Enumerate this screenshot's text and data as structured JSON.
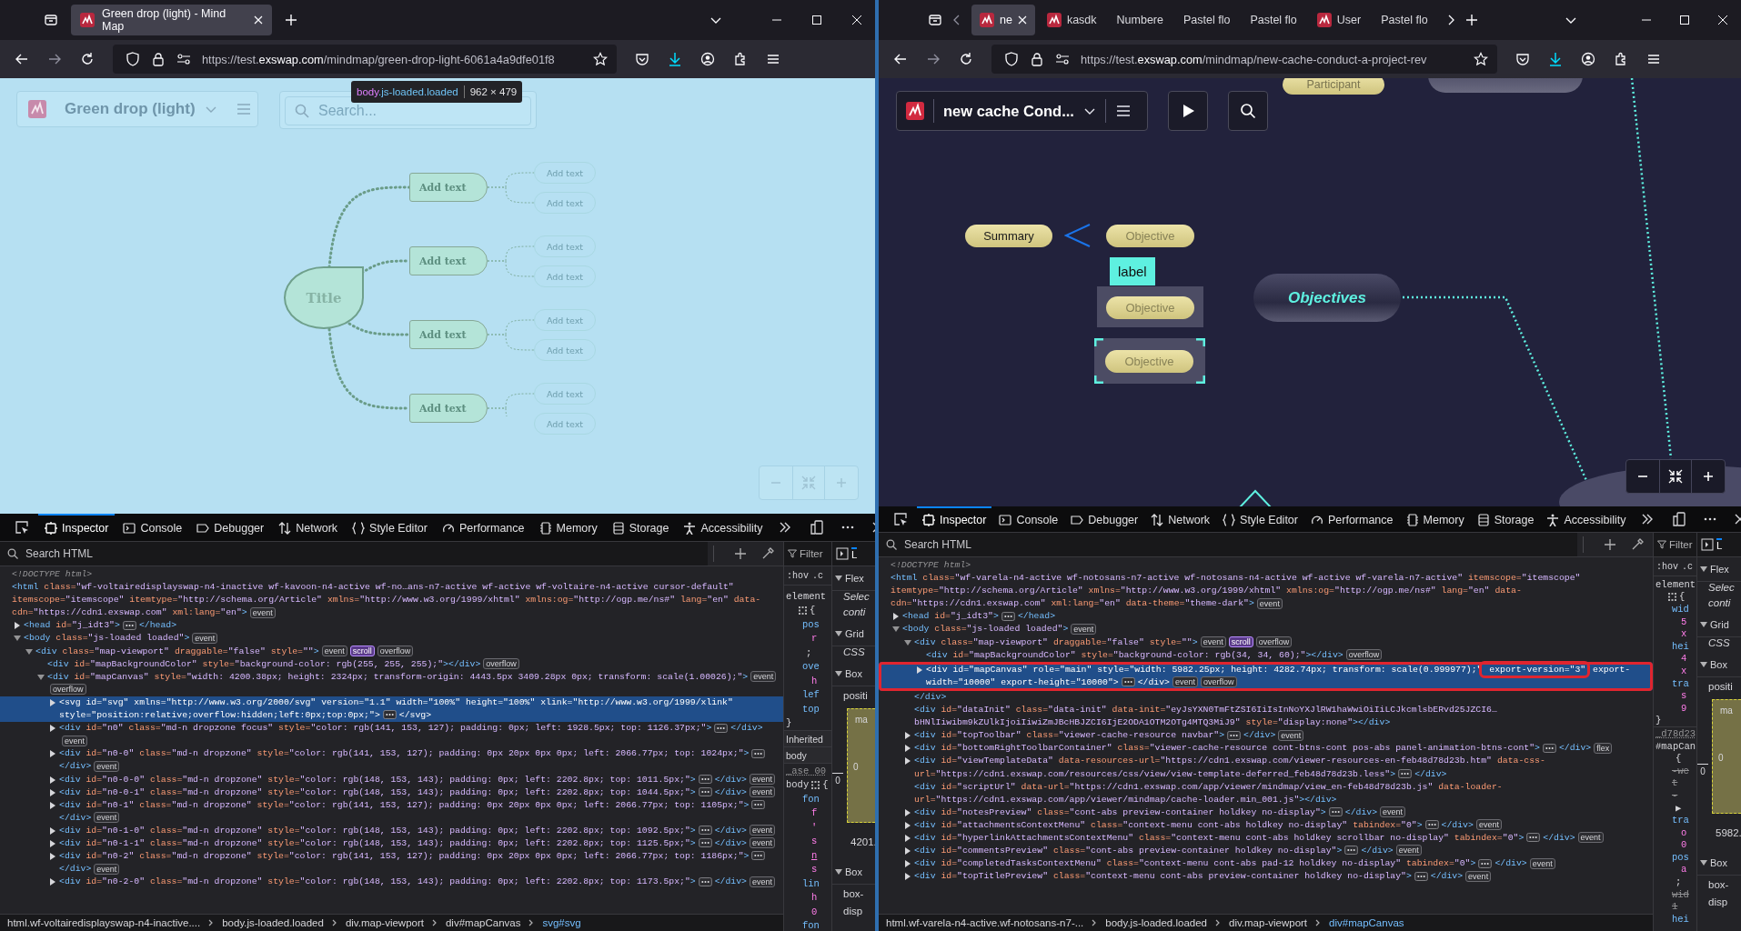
{
  "windows": [
    {
      "tabs": [
        {
          "title": "Green drop (light) - Mind Map",
          "selected": true,
          "favicon": true
        }
      ],
      "url": {
        "scheme": "https://test.",
        "host": "exswap.com",
        "path": "/mindmap/green-drop-light-6061a4a9dfe01f8"
      },
      "page": {
        "kind": "light-map",
        "title": "Green drop (light)",
        "search": {
          "placeholder": "Search..."
        },
        "tooltip": {
          "tag": "body",
          "classes": ".js-loaded.loaded",
          "size": "962 × 479"
        },
        "root": "Title",
        "branches": [
          {
            "label": "Add text",
            "leaves": [
              "Add text",
              "Add text"
            ]
          },
          {
            "label": "Add text",
            "leaves": [
              "Add text",
              "Add text"
            ]
          },
          {
            "label": "Add text",
            "leaves": [
              "Add text",
              "Add text"
            ]
          },
          {
            "label": "Add text",
            "leaves": [
              "Add text",
              "Add text"
            ]
          }
        ]
      },
      "devtools": {
        "tabs": [
          {
            "label": "Inspector",
            "kind": "inspector",
            "selected": true
          },
          {
            "label": "Console",
            "kind": "console",
            "selected": false
          },
          {
            "label": "Debugger",
            "kind": "debugger",
            "selected": false
          },
          {
            "label": "Network",
            "kind": "network",
            "selected": false
          },
          {
            "label": "Style Editor",
            "kind": "styles",
            "selected": false
          },
          {
            "label": "Performance",
            "kind": "performance",
            "selected": false
          },
          {
            "label": "Memory",
            "kind": "memory",
            "selected": false
          },
          {
            "label": "Storage",
            "kind": "storage",
            "selected": false
          },
          {
            "label": "Accessibility",
            "kind": "accessibility",
            "selected": false
          }
        ],
        "search": {
          "placeholder": "Search HTML"
        },
        "tree": [
          {
            "text": "<!DOCTYPE html>",
            "kind": "leaf",
            "selected": false
          },
          {
            "text": "<html class=\"wf-voltairedisplayswap-n4-inactive wf-kavoon-n4-active wf-no…ans-n7-active wf-active wf-voltaire-n4-active cursor-default\" itemscope=\"itemscope\" itemtype=\"http://schema.org/Article\" xmlns=\"http://www.w3.org/1999/xhtml\" xmlns:og=\"http://ogp.me/ns#\" lang=\"en\" data-cdn=\"https://cdn1.exswap.com\" xml:lang=\"en\">",
            "kind": "leaf",
            "selected": false,
            "badges": [
              {
                "label": "event",
                "active": false
              }
            ],
            "children": [
              {
                "text": "<head id=\"j_idt3\">",
                "ellipsis": true,
                "closing": "</head>",
                "kind": "collapsed",
                "selected": false
              },
              {
                "text": "<body class=\"js-loaded loaded\">",
                "kind": "expanded",
                "selected": false,
                "badges": [
                  {
                    "label": "event",
                    "active": false
                  }
                ],
                "children": [
                  {
                    "text": "<div class=\"map-viewport\" draggable=\"false\" style=\"\">",
                    "kind": "expanded",
                    "selected": false,
                    "badges": [
                      {
                        "label": "event",
                        "active": false
                      },
                      {
                        "label": "scroll",
                        "active": true
                      },
                      {
                        "label": "overflow",
                        "active": false
                      }
                    ],
                    "children": [
                      {
                        "text": "<div id=\"mapBackgroundColor\" style=\"background-color: rgb(255, 255, 255);\">",
                        "ellipsis": false,
                        "closing": "</div>",
                        "kind": "leaf",
                        "selected": false,
                        "badges": [
                          {
                            "label": "overflow",
                            "active": false
                          }
                        ]
                      },
                      {
                        "text": "<div id=\"mapCanvas\" style=\"width: 4200.38px; height: 2324px; transform-origin: 4443.5px 3409.28px 0px; transform: scale(1.00026);\">",
                        "kind": "expanded",
                        "selected": false,
                        "badges": [
                          {
                            "label": "event",
                            "active": false
                          },
                          {
                            "label": "overflow",
                            "active": false
                          }
                        ],
                        "children": [
                          {
                            "text": "<svg id=\"svg\" xmlns=\"http://www.w3.org/2000/svg\" version=\"1.1\" width=\"100%\" height=\"100%\" xlink=\"http://www.w3.org/1999/xlink\" style=\"position:relative;overflow:hidden;left:0px;top:0px;\">",
                            "ellipsis": true,
                            "closing": "</svg>",
                            "kind": "collapsed",
                            "selected": true
                          },
                          {
                            "text": "<div id=\"n0\" class=\"md-n dropzone focus\" style=\"color: rgb(141, 153, 127); padding: 0px; left: 1928.5px; top: 1126.37px;\">",
                            "ellipsis": true,
                            "closing": "</div>",
                            "kind": "collapsed",
                            "selected": false,
                            "badges": [
                              {
                                "label": "event",
                                "active": false
                              }
                            ]
                          },
                          {
                            "text": "<div id=\"n0-0\" class=\"md-n dropzone\" style=\"color: rgb(141, 153, 127); padding: 0px 20px 0px 0px; left: 2066.77px; top: 1024px;\">",
                            "ellipsis": true,
                            "closing": "</div>",
                            "kind": "collapsed",
                            "selected": false,
                            "badges": [
                              {
                                "label": "event",
                                "active": false
                              }
                            ]
                          },
                          {
                            "text": "<div id=\"n0-0-0\" class=\"md-n dropzone\" style=\"color: rgb(148, 153, 143); padding: 0px; left: 2202.8px; top: 1011.5px;\">",
                            "ellipsis": true,
                            "closing": "</div>",
                            "kind": "collapsed",
                            "selected": false,
                            "badges": [
                              {
                                "label": "event",
                                "active": false
                              }
                            ]
                          },
                          {
                            "text": "<div id=\"n0-0-1\" class=\"md-n dropzone\" style=\"color: rgb(148, 153, 143); padding: 0px; left: 2202.8px; top: 1044.5px;\">",
                            "ellipsis": true,
                            "closing": "</div>",
                            "kind": "collapsed",
                            "selected": false,
                            "badges": [
                              {
                                "label": "event",
                                "active": false
                              }
                            ]
                          },
                          {
                            "text": "<div id=\"n0-1\" class=\"md-n dropzone\" style=\"color: rgb(141, 153, 127); padding: 0px 20px 0px 0px; left: 2066.77px; top: 1105px;\">",
                            "ellipsis": true,
                            "closing": "</div>",
                            "kind": "collapsed",
                            "selected": false,
                            "badges": [
                              {
                                "label": "event",
                                "active": false
                              }
                            ]
                          },
                          {
                            "text": "<div id=\"n0-1-0\" class=\"md-n dropzone\" style=\"color: rgb(148, 153, 143); padding: 0px; left: 2202.8px; top: 1092.5px;\">",
                            "ellipsis": true,
                            "closing": "</div>",
                            "kind": "collapsed",
                            "selected": false,
                            "badges": [
                              {
                                "label": "event",
                                "active": false
                              }
                            ]
                          },
                          {
                            "text": "<div id=\"n0-1-1\" class=\"md-n dropzone\" style=\"color: rgb(148, 153, 143); padding: 0px; left: 2202.8px; top: 1125.5px;\">",
                            "ellipsis": true,
                            "closing": "</div>",
                            "kind": "collapsed",
                            "selected": false,
                            "badges": [
                              {
                                "label": "event",
                                "active": false
                              }
                            ]
                          },
                          {
                            "text": "<div id=\"n0-2\" class=\"md-n dropzone\" style=\"color: rgb(141, 153, 127); padding: 0px 20px 0px 0px; left: 2066.77px; top: 1186px;\">",
                            "ellipsis": true,
                            "closing": "</div>",
                            "kind": "collapsed",
                            "selected": false,
                            "badges": [
                              {
                                "label": "event",
                                "active": false
                              }
                            ]
                          },
                          {
                            "text": "<div id=\"n0-2-0\" class=\"md-n dropzone\" style=\"color: rgb(148, 153, 143); padding: 0px; left: 2202.8px; top: 1173.5px;\">",
                            "ellipsis": true,
                            "closing": "</div>",
                            "kind": "collapsed",
                            "selected": false,
                            "badges": [
                              {
                                "label": "event",
                                "active": false
                              }
                            ]
                          }
                        ]
                      }
                    ]
                  }
                ]
              }
            ]
          }
        ],
        "breadcrumbs": [
          {
            "label": "html.wf-voltairedisplayswap-n4-inactive....",
            "selected": false
          },
          {
            "label": "body.js-loaded.loaded",
            "selected": false
          },
          {
            "label": "div.map-viewport",
            "selected": false
          },
          {
            "label": "div#mapCanvas",
            "selected": false
          },
          {
            "label": "svg#svg",
            "selected": true
          }
        ],
        "rules": {
          "filter": "Filter",
          "pseudo": ":hov",
          "classes": ".c",
          "lines": [
            {
              "text": "element",
              "kind": "selector"
            },
            {
              "text": "{",
              "kind": "open"
            },
            {
              "text": "pos",
              "kind": "prop"
            },
            {
              "text": "r",
              "kind": "value"
            },
            {
              "text": ";",
              "kind": "plain"
            },
            {
              "text": "ove",
              "kind": "prop"
            },
            {
              "text": "h",
              "kind": "value"
            },
            {
              "text": "lef",
              "kind": "prop"
            },
            {
              "text": "top",
              "kind": "prop"
            },
            {
              "text": "}",
              "kind": "close"
            },
            {
              "text": "Inherited",
              "kind": "header"
            },
            {
              "text": "body",
              "kind": "header"
            },
            {
              "text": "_ase 00",
              "kind": "source"
            },
            {
              "text": "body",
              "kind": "selector-open",
              "suffix": "{"
            },
            {
              "text": "fon",
              "kind": "prop"
            },
            {
              "text": "f",
              "kind": "value"
            },
            {
              "text": "'",
              "kind": "value"
            },
            {
              "text": "s",
              "kind": "value"
            },
            {
              "text": "n",
              "kind": "link"
            },
            {
              "text": "s",
              "kind": "value"
            },
            {
              "text": "lin",
              "kind": "prop"
            },
            {
              "text": "h",
              "kind": "value"
            },
            {
              "text": "0",
              "kind": "value"
            },
            {
              "text": "fon",
              "kind": "prop"
            }
          ]
        },
        "layout": {
          "tab": "L",
          "lines": [
            {
              "kind": "section",
              "text": "Flex"
            },
            {
              "kind": "note",
              "text": "Selec"
            },
            {
              "kind": "note",
              "text": "conti"
            },
            {
              "kind": "section",
              "text": "Grid"
            },
            {
              "kind": "note",
              "text": "CSS"
            },
            {
              "kind": "section",
              "text": "Box"
            },
            {
              "kind": "label",
              "text": "positi"
            },
            {
              "kind": "box-model",
              "label": "ma",
              "inner": "0",
              "outer": "0"
            },
            {
              "kind": "size",
              "text": "4201."
            },
            {
              "kind": "section",
              "text": "Box"
            },
            {
              "kind": "label",
              "text": "box-"
            },
            {
              "kind": "label",
              "text": "disp"
            }
          ]
        }
      }
    },
    {
      "tabs": [
        {
          "title": "ne",
          "selected": true,
          "favicon": true
        },
        {
          "title": "kasdk",
          "selected": false,
          "favicon": true
        },
        {
          "title": "Numbere",
          "selected": false,
          "favicon": false
        },
        {
          "title": "Pastel flo",
          "selected": false,
          "favicon": false
        },
        {
          "title": "Pastel flo",
          "selected": false,
          "favicon": false
        },
        {
          "title": "User",
          "selected": false,
          "favicon": true
        },
        {
          "title": "Pastel flo",
          "selected": false,
          "favicon": false
        }
      ],
      "tab_scroll": true,
      "url": {
        "scheme": "https://test.",
        "host": "exswap.com",
        "path": "/mindmap/new-cache-conduct-a-project-rev"
      },
      "page": {
        "kind": "dark-map",
        "title": "new cache Cond...",
        "top_node": "Participant",
        "summary": "Summary",
        "central": "Objectives",
        "objectives": [
          {
            "label": "Objective",
            "kind": "plain"
          },
          {
            "label": "Objective",
            "kind": "boxed",
            "tag": "label"
          },
          {
            "label": "Objective",
            "kind": "selected"
          }
        ]
      },
      "devtools": {
        "tabs": [
          {
            "label": "Inspector",
            "kind": "inspector",
            "selected": true
          },
          {
            "label": "Console",
            "kind": "console",
            "selected": false
          },
          {
            "label": "Debugger",
            "kind": "debugger",
            "selected": false
          },
          {
            "label": "Network",
            "kind": "network",
            "selected": false
          },
          {
            "label": "Style Editor",
            "kind": "styles",
            "selected": false
          },
          {
            "label": "Performance",
            "kind": "performance",
            "selected": false
          },
          {
            "label": "Memory",
            "kind": "memory",
            "selected": false
          },
          {
            "label": "Storage",
            "kind": "storage",
            "selected": false
          },
          {
            "label": "Accessibility",
            "kind": "accessibility",
            "selected": false
          }
        ],
        "search": {
          "placeholder": "Search HTML"
        },
        "tree": [
          {
            "text": "<!DOCTYPE html>",
            "kind": "leaf",
            "selected": false
          },
          {
            "text": "<html class=\"wf-varela-n4-active wf-notosans-n7-active wf-notosans-n4-active wf-active wf-varela-n7-active\" itemscope=\"itemscope\" itemtype=\"http://schema.org/Article\" xmlns=\"http://www.w3.org/1999/xhtml\" xmlns:og=\"http://ogp.me/ns#\" lang=\"en\" data-cdn=\"https://cdn1.exswap.com\" xml:lang=\"en\" data-theme=\"theme-dark\">",
            "kind": "leaf",
            "selected": false,
            "badges": [
              {
                "label": "event",
                "active": false
              }
            ],
            "children": [
              {
                "text": "<head id=\"j_idt3\">",
                "ellipsis": true,
                "closing": "</head>",
                "kind": "collapsed",
                "selected": false
              },
              {
                "text": "<body class=\"js-loaded loaded\">",
                "kind": "expanded",
                "selected": false,
                "badges": [
                  {
                    "label": "event",
                    "active": false
                  }
                ],
                "children": [
                  {
                    "text": "<div class=\"map-viewport\" draggable=\"false\" style=\"\">",
                    "kind": "expanded",
                    "selected": false,
                    "badges": [
                      {
                        "label": "event",
                        "active": false
                      },
                      {
                        "label": "scroll",
                        "active": true
                      },
                      {
                        "label": "overflow",
                        "active": false
                      }
                    ],
                    "children": [
                      {
                        "text": "<div id=\"mapBackgroundColor\" style=\"background-color: rgb(34, 34, 60);\">",
                        "ellipsis": false,
                        "closing": "</div>",
                        "kind": "leaf",
                        "selected": false,
                        "badges": [
                          {
                            "label": "overflow",
                            "active": false
                          }
                        ]
                      },
                      {
                        "text": "<div id=\"mapCanvas\" role=\"main\" style=\"width: 5982.25px; height: 4282.74px; transform: scale(0.999977);\"",
                        "marked": "export-version=\"3\"",
                        "after": " export-width=\"10000\" export-height=\"10000\">",
                        "ellipsis": true,
                        "closing": "</div>",
                        "kind": "collapsed",
                        "selected": true,
                        "boxed": true,
                        "badges": [
                          {
                            "label": "event",
                            "active": false
                          },
                          {
                            "label": "overflow",
                            "active": false
                          }
                        ]
                      }
                    ]
                  },
                  {
                    "text": "</div>",
                    "kind": "leaf",
                    "selected": false
                  },
                  {
                    "text": "<div id=\"dataInit\" class=\"data-init\" data-init=\"eyJsYXN0TmFtZSI6IiIsInNoYXJlRW1haWwiOiIiLCJkcmlsbERvd25JZCI6…bHNlIiwibm9kZUlkIjoiIiwiZmJBcHBJZCI6IjE2ODA1OTM2OTg4MTQ3MiJ9\" style=\"display:none\">",
                    "ellipsis": false,
                    "closing": "</div>",
                    "kind": "leaf",
                    "selected": false
                  },
                  {
                    "text": "<div id=\"topToolbar\" class=\"viewer-cache-resource navbar\">",
                    "ellipsis": true,
                    "closing": "</div>",
                    "kind": "collapsed",
                    "selected": false,
                    "badges": [
                      {
                        "label": "event",
                        "active": false
                      }
                    ]
                  },
                  {
                    "text": "<div id=\"bottomRightToolbarContainer\" class=\"viewer-cache-resource cont-btns-cont pos-abs panel-animation-btns-cont\">",
                    "ellipsis": true,
                    "closing": "</div>",
                    "kind": "collapsed",
                    "selected": false,
                    "badges": [
                      {
                        "label": "flex",
                        "active": false
                      }
                    ]
                  },
                  {
                    "text": "<div id=\"viewTemplateData\" data-resources-url=\"https://cdn1.exswap.com/viewer-resources-en-feb48d78d23b.htm\" data-css-url=\"https://cdn1.exswap.com/resources/css/view/view-template-deferred_feb48d78d23b.less\">",
                    "ellipsis": true,
                    "closing": "</div>",
                    "kind": "collapsed",
                    "selected": false
                  },
                  {
                    "text": "<div id=\"scriptUrl\" data-url=\"https://cdn1.exswap.com/app/viewer/mindmap/view_en-feb48d78d23b.js\" data-loader-url=\"https://cdn1.exswap.com/app/viewer/mindmap/cache-loader.min_001.js\">",
                    "ellipsis": false,
                    "closing": "</div>",
                    "kind": "leaf",
                    "selected": false
                  },
                  {
                    "text": "<div id=\"notesPreview\" class=\"cont-abs preview-container holdkey no-display\">",
                    "ellipsis": true,
                    "closing": "</div>",
                    "kind": "collapsed",
                    "selected": false,
                    "badges": [
                      {
                        "label": "event",
                        "active": false
                      }
                    ]
                  },
                  {
                    "text": "<div id=\"attachmentsContextMenu\" class=\"context-menu cont-abs holdkey no-display\" tabindex=\"0\">",
                    "ellipsis": true,
                    "closing": "</div>",
                    "kind": "collapsed",
                    "selected": false,
                    "badges": [
                      {
                        "label": "event",
                        "active": false
                      }
                    ]
                  },
                  {
                    "text": "<div id=\"hyperlinkAttachmentsContextMenu\" class=\"context-menu cont-abs holdkey scrollbar no-display\" tabindex=\"0\">",
                    "ellipsis": true,
                    "closing": "</div>",
                    "kind": "collapsed",
                    "selected": false,
                    "badges": [
                      {
                        "label": "event",
                        "active": false
                      }
                    ]
                  },
                  {
                    "text": "<div id=\"commentsPreview\" class=\"cont-abs preview-container holdkey no-display\">",
                    "ellipsis": true,
                    "closing": "</div>",
                    "kind": "collapsed",
                    "selected": false,
                    "badges": [
                      {
                        "label": "event",
                        "active": false
                      }
                    ]
                  },
                  {
                    "text": "<div id=\"completedTasksContextMenu\" class=\"context-menu cont-abs pad-12 holdkey no-display\" tabindex=\"0\">",
                    "ellipsis": true,
                    "closing": "</div>",
                    "kind": "collapsed",
                    "selected": false,
                    "badges": [
                      {
                        "label": "event",
                        "active": false
                      }
                    ]
                  },
                  {
                    "text": "<div id=\"topTitlePreview\" class=\"context-menu cont-abs preview-container holdkey no-display\">",
                    "ellipsis": true,
                    "closing": "</div>",
                    "kind": "collapsed",
                    "selected": false,
                    "badges": [
                      {
                        "label": "event",
                        "active": false
                      }
                    ]
                  }
                ]
              }
            ]
          }
        ],
        "breadcrumbs": [
          {
            "label": "html.wf-varela-n4-active.wf-notosans-n7-...",
            "selected": false
          },
          {
            "label": "body.js-loaded.loaded",
            "selected": false
          },
          {
            "label": "div.map-viewport",
            "selected": false
          },
          {
            "label": "div#mapCanvas",
            "selected": true
          }
        ],
        "rules": {
          "filter": "Filter",
          "pseudo": ":hov",
          "classes": ".c",
          "lines": [
            {
              "text": "element",
              "kind": "selector"
            },
            {
              "text": "{",
              "kind": "open"
            },
            {
              "text": "wid",
              "kind": "prop"
            },
            {
              "text": "5",
              "kind": "value"
            },
            {
              "text": "x",
              "kind": "value"
            },
            {
              "text": "hei",
              "kind": "prop"
            },
            {
              "text": "4",
              "kind": "value"
            },
            {
              "text": "x",
              "kind": "value"
            },
            {
              "text": "tra",
              "kind": "prop"
            },
            {
              "text": "s",
              "kind": "value"
            },
            {
              "text": "9",
              "kind": "value"
            },
            {
              "text": "}",
              "kind": "close"
            },
            {
              "text": "_d78d23",
              "kind": "source"
            },
            {
              "text": "#mapCan",
              "kind": "selector"
            },
            {
              "text": "{",
              "kind": "plain"
            },
            {
              "text": "-we",
              "kind": "struck"
            },
            {
              "text": "t",
              "kind": "struck"
            },
            {
              "text": "-",
              "kind": "struck"
            },
            {
              "text": "▶",
              "kind": "plain"
            },
            {
              "text": "tra",
              "kind": "prop"
            },
            {
              "text": "o",
              "kind": "value"
            },
            {
              "text": "0",
              "kind": "value"
            },
            {
              "text": "pos",
              "kind": "prop"
            },
            {
              "text": "a",
              "kind": "value"
            },
            {
              "text": ";",
              "kind": "plain"
            },
            {
              "text": "wid",
              "kind": "struck"
            },
            {
              "text": "1",
              "kind": "struck"
            },
            {
              "text": "hei",
              "kind": "prop"
            }
          ]
        },
        "layout": {
          "tab": "L",
          "lines": [
            {
              "kind": "section",
              "text": "Flex"
            },
            {
              "kind": "note",
              "text": "Selec"
            },
            {
              "kind": "note",
              "text": "conti"
            },
            {
              "kind": "section",
              "text": "Grid"
            },
            {
              "kind": "note",
              "text": "CSS"
            },
            {
              "kind": "section",
              "text": "Box"
            },
            {
              "kind": "label",
              "text": "positi"
            },
            {
              "kind": "box-model",
              "label": "ma",
              "inner": "0",
              "outer": "0"
            },
            {
              "kind": "size",
              "text": "5982."
            },
            {
              "kind": "section",
              "text": "Box"
            },
            {
              "kind": "label",
              "text": "box-"
            },
            {
              "kind": "label",
              "text": "disp"
            }
          ]
        }
      }
    }
  ]
}
